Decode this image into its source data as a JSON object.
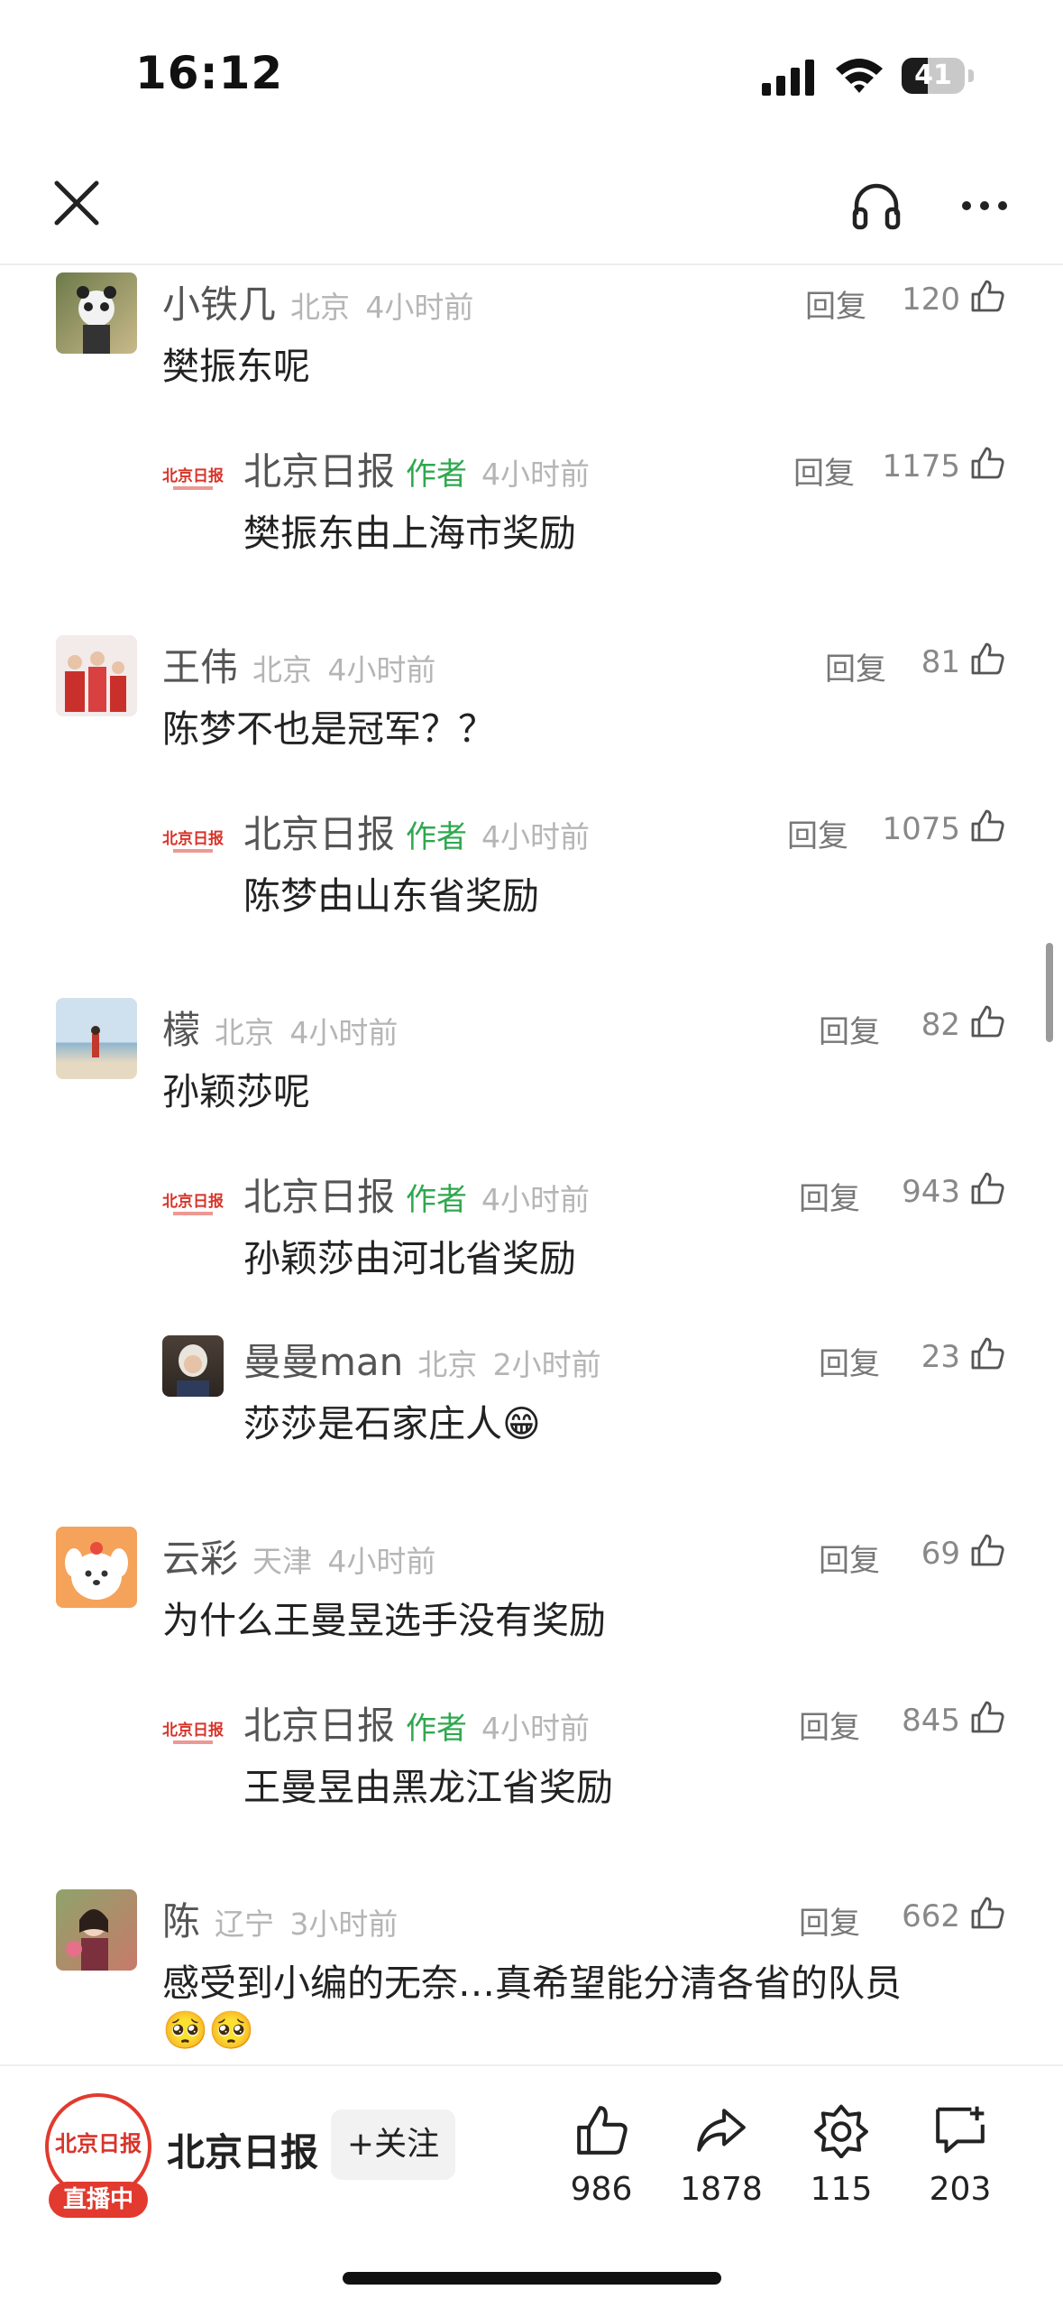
{
  "status_bar": {
    "time": "16:12",
    "battery": "41",
    "battery_level_percent": 41
  },
  "nav": {
    "close_icon": "close-icon",
    "audio_icon": "headphone-icon",
    "more_icon": "more-icon"
  },
  "reply_label": "回复",
  "comments": [
    {
      "name": "小铁几",
      "location": "北京",
      "time": "4小时前",
      "likes": "120",
      "text": "樊振东呢"
    },
    {
      "name": "北京日报",
      "tag": "作者",
      "time": "4小时前",
      "likes": "1175",
      "text": "樊振东由上海市奖励"
    },
    {
      "name": "王伟",
      "location": "北京",
      "time": "4小时前",
      "likes": "81",
      "text": "陈梦不也是冠军？？"
    },
    {
      "name": "北京日报",
      "tag": "作者",
      "time": "4小时前",
      "likes": "1075",
      "text": "陈梦由山东省奖励"
    },
    {
      "name": "檬",
      "location": "北京",
      "time": "4小时前",
      "likes": "82",
      "text": "孙颖莎呢"
    },
    {
      "name": "北京日报",
      "tag": "作者",
      "time": "4小时前",
      "likes": "943",
      "text": "孙颖莎由河北省奖励"
    },
    {
      "name": "曼曼man",
      "location": "北京",
      "time": "2小时前",
      "likes": "23",
      "text": "莎莎是石家庄人😁"
    },
    {
      "name": "云彩",
      "location": "天津",
      "time": "4小时前",
      "likes": "69",
      "text": "为什么王曼昱选手没有奖励"
    },
    {
      "name": "北京日报",
      "tag": "作者",
      "time": "4小时前",
      "likes": "845",
      "text": "王曼昱由黑龙江省奖励"
    },
    {
      "name": "陈",
      "location": "辽宁",
      "time": "3小时前",
      "likes": "662",
      "text": "感受到小编的无奈…真希望能分清各省的队员",
      "text2": "🥺🥺"
    }
  ],
  "logo_text": "北京日报",
  "bottom_bar": {
    "account_name": "北京日报",
    "live_badge": "直播中",
    "follow_label": "+关注",
    "actions": [
      {
        "icon": "like-icon",
        "count": "986"
      },
      {
        "icon": "share-icon",
        "count": "1878"
      },
      {
        "icon": "collect-icon",
        "count": "115"
      },
      {
        "icon": "comment-icon",
        "count": "203"
      }
    ]
  }
}
